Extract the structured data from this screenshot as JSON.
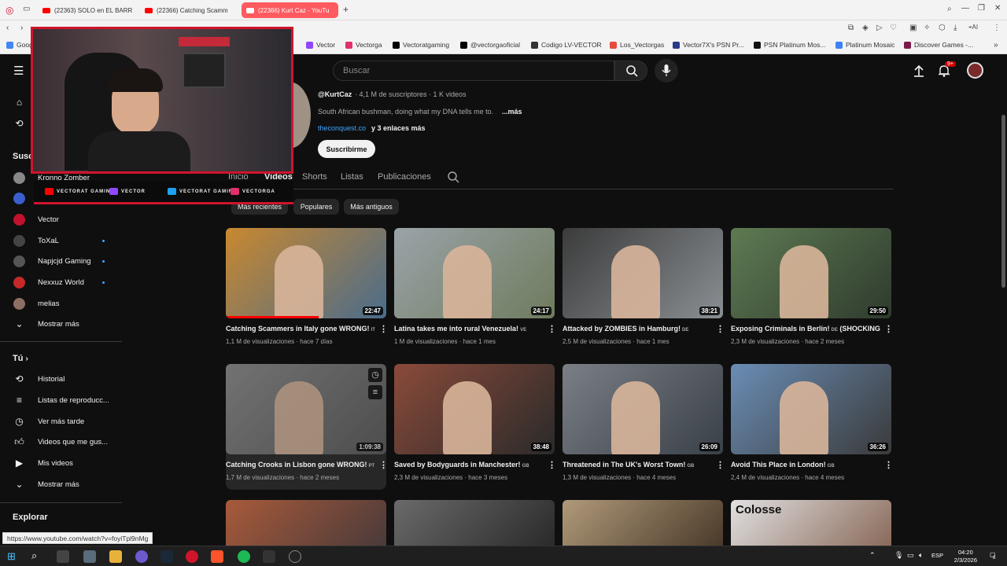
{
  "browser": {
    "tabs": [
      {
        "label": "(22363) SOLO en EL BARR",
        "active": false
      },
      {
        "label": "(22366) Catching Scamm",
        "active": false
      },
      {
        "label": "(22366) Kurt Caz - YouTu",
        "active": true
      }
    ],
    "new_tab": "+",
    "bookmarks": [
      {
        "label": "Goog",
        "color": "#4285f4"
      },
      {
        "label": "Vector",
        "color": "#9146ff"
      },
      {
        "label": "Vectorga",
        "color": "#e1306c"
      },
      {
        "label": "Vectoratgaming",
        "color": "#000000"
      },
      {
        "label": "@vectorgaoficial",
        "color": "#000000"
      },
      {
        "label": "Codigo LV-VECTOR",
        "color": "#333333"
      },
      {
        "label": "Los_Vectorgas",
        "color": "#e74c3c"
      },
      {
        "label": "Vector7X's PSN Pr...",
        "color": "#2a3a8a"
      },
      {
        "label": "PSN Platinum Mos...",
        "color": "#111111"
      },
      {
        "label": "Platinum Mosaic",
        "color": "#3b82f6"
      },
      {
        "label": "Discover Games -...",
        "color": "#7a1a4a"
      }
    ],
    "status_url": "https://www.youtube.com/watch?v=foyiTpl9nMg"
  },
  "header": {
    "search_placeholder": "Buscar",
    "notif_badge": "9+"
  },
  "sidebar": {
    "subs_title": "Susc",
    "subscriptions": [
      {
        "label": "Kronno Zomber",
        "color": "#888888",
        "dot": false
      },
      {
        "label": "",
        "color": "#3a5fcd",
        "dot": false
      },
      {
        "label": "Vector",
        "color": "#c0122c",
        "dot": false
      },
      {
        "label": "ToXaL",
        "color": "#444444",
        "dot": true
      },
      {
        "label": "Napjcjd Gaming",
        "color": "#555555",
        "dot": true
      },
      {
        "label": "Nexxuz World",
        "color": "#c62828",
        "dot": true
      },
      {
        "label": "melias",
        "color": "#8d6e63",
        "dot": false
      }
    ],
    "show_more_1": "Mostrar más",
    "you_title": "Tú",
    "you_items": [
      {
        "label": "Historial",
        "icon": "history-icon"
      },
      {
        "label": "Listas de reproducc...",
        "icon": "playlists-icon"
      },
      {
        "label": "Ver más tarde",
        "icon": "watch-later-icon"
      },
      {
        "label": "Videos que me gus...",
        "icon": "like-icon"
      },
      {
        "label": "Mis videos",
        "icon": "my-videos-icon"
      }
    ],
    "show_more_2": "Mostrar más",
    "explore_title": "Explorar"
  },
  "channel": {
    "handle": "@KurtCaz",
    "stats": "· 4,1 M de suscriptores · 1 K videos",
    "description": "South African bushman, doing what my DNA tells me to.",
    "more": "...más",
    "link": "theconquest.co",
    "link_more": "y 3 enlaces más",
    "subscribe": "Suscribirme",
    "tabs": [
      "Inicio",
      "Videos",
      "Shorts",
      "Listas",
      "Publicaciones"
    ],
    "active_tab": "Videos",
    "chips": [
      "Más recientes",
      "Populares",
      "Más antiguos"
    ]
  },
  "videos": [
    {
      "title": "Catching Scammers in Italy gone WRONG!",
      "flag": "IT",
      "views": "1,1 M de visualizaciones",
      "age": "hace 7 días",
      "duration": "22:47",
      "bg1": "#c9882f",
      "bg2": "#4a6c8c",
      "watched": 0.58
    },
    {
      "title": "Latina takes me into rural Venezuela!",
      "flag": "VE",
      "views": "1 M de visualizaciones",
      "age": "hace 1 mes",
      "duration": "24:17",
      "bg1": "#9aa3a8",
      "bg2": "#6f7b5e",
      "watched": 0
    },
    {
      "title": "Attacked by ZOMBIES in Hamburg!",
      "flag": "DE",
      "views": "2,5 M de visualizaciones",
      "age": "hace 1 mes",
      "duration": "38:21",
      "bg1": "#3b3b3b",
      "bg2": "#8a8f93",
      "watched": 0
    },
    {
      "title": "Exposing Criminals in Berlin!",
      "flag": "DE",
      "extra": "(SHOCKING)",
      "views": "2,3 M de visualizaciones",
      "age": "hace 2 meses",
      "duration": "29:50",
      "bg1": "#5e7a52",
      "bg2": "#2f3b2e",
      "watched": 0
    },
    {
      "title": "Catching Crooks in Lisbon gone WRONG!",
      "flag": "PT",
      "views": "1,7 M de visualizaciones",
      "age": "hace 2 meses",
      "duration": "1:09:38",
      "bg1": "#8c8c8c",
      "bg2": "#5a5a5a",
      "watched": 0
    },
    {
      "title": "Saved by Bodyguards in Manchester!",
      "flag": "GB",
      "views": "2,3 M de visualizaciones",
      "age": "hace 3 meses",
      "duration": "38:48",
      "bg1": "#8a4a3a",
      "bg2": "#2a2a2a",
      "watched": 0
    },
    {
      "title": "Threatened in The UK's Worst Town!",
      "flag": "GB",
      "views": "1,3 M de visualizaciones",
      "age": "hace 4 meses",
      "duration": "26:09",
      "bg1": "#7a7f86",
      "bg2": "#3a4048",
      "watched": 0
    },
    {
      "title": "Avoid This Place in London!",
      "flag": "GB",
      "views": "2,4 M de visualizaciones",
      "age": "hace 4 meses",
      "duration": "36:26",
      "bg1": "#6a8db5",
      "bg2": "#3a3a3a",
      "watched": 0
    }
  ],
  "next_row_thumbs": [
    {
      "bg1": "#a85a3a",
      "bg2": "#4a3a3a",
      "text": ""
    },
    {
      "bg1": "#6a6a6a",
      "bg2": "#2a2a2a",
      "text": ""
    },
    {
      "bg1": "#b09a7a",
      "bg2": "#4a3a2a",
      "text": ""
    },
    {
      "bg1": "#e0e0e0",
      "bg2": "#8a6a5a",
      "text": "Colosse"
    }
  ],
  "overlay": {
    "socials": [
      {
        "label": "VECTORAT GAMING",
        "color": "#ff0000"
      },
      {
        "label": "VECTOR",
        "color": "#9146ff"
      },
      {
        "label": "VECTORAT GAMING",
        "color": "#1da1f2"
      },
      {
        "label": "VECTORGA",
        "color": "#e1306c"
      }
    ]
  },
  "taskbar": {
    "time": "04:20",
    "date": "2/3/2026",
    "lang": "ESP",
    "notif_count": "8"
  }
}
